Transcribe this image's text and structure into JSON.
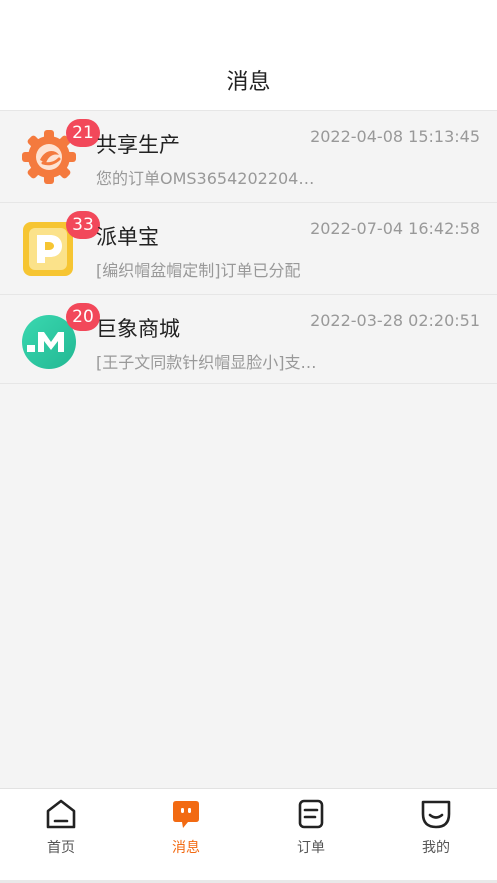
{
  "header": {
    "title": "消息"
  },
  "conversations": [
    {
      "name": "共享生产",
      "badge": "21",
      "time": "2022-04-08 15:13:45",
      "preview": "您的订单OMS36542022040…",
      "avatar_icon": "gear-logo-icon",
      "avatar_color": "#f47a3e"
    },
    {
      "name": "派单宝",
      "badge": "33",
      "time": "2022-07-04 16:42:58",
      "preview": "[编织帽盆帽定制]订单已分配",
      "avatar_icon": "p-logo-icon",
      "avatar_color": "#f6c532"
    },
    {
      "name": "巨象商城",
      "badge": "20",
      "time": "2022-03-28 02:20:51",
      "preview": "[王子文同款针织帽显脸小]支…",
      "avatar_icon": "m-logo-icon",
      "avatar_color": "#2fd0a0"
    }
  ],
  "tabbar": {
    "items": [
      {
        "label": "首页",
        "icon": "home-icon",
        "active": false
      },
      {
        "label": "消息",
        "icon": "message-icon",
        "active": true
      },
      {
        "label": "订单",
        "icon": "order-icon",
        "active": false
      },
      {
        "label": "我的",
        "icon": "profile-icon",
        "active": false
      }
    ],
    "active_color": "#f26a12"
  }
}
